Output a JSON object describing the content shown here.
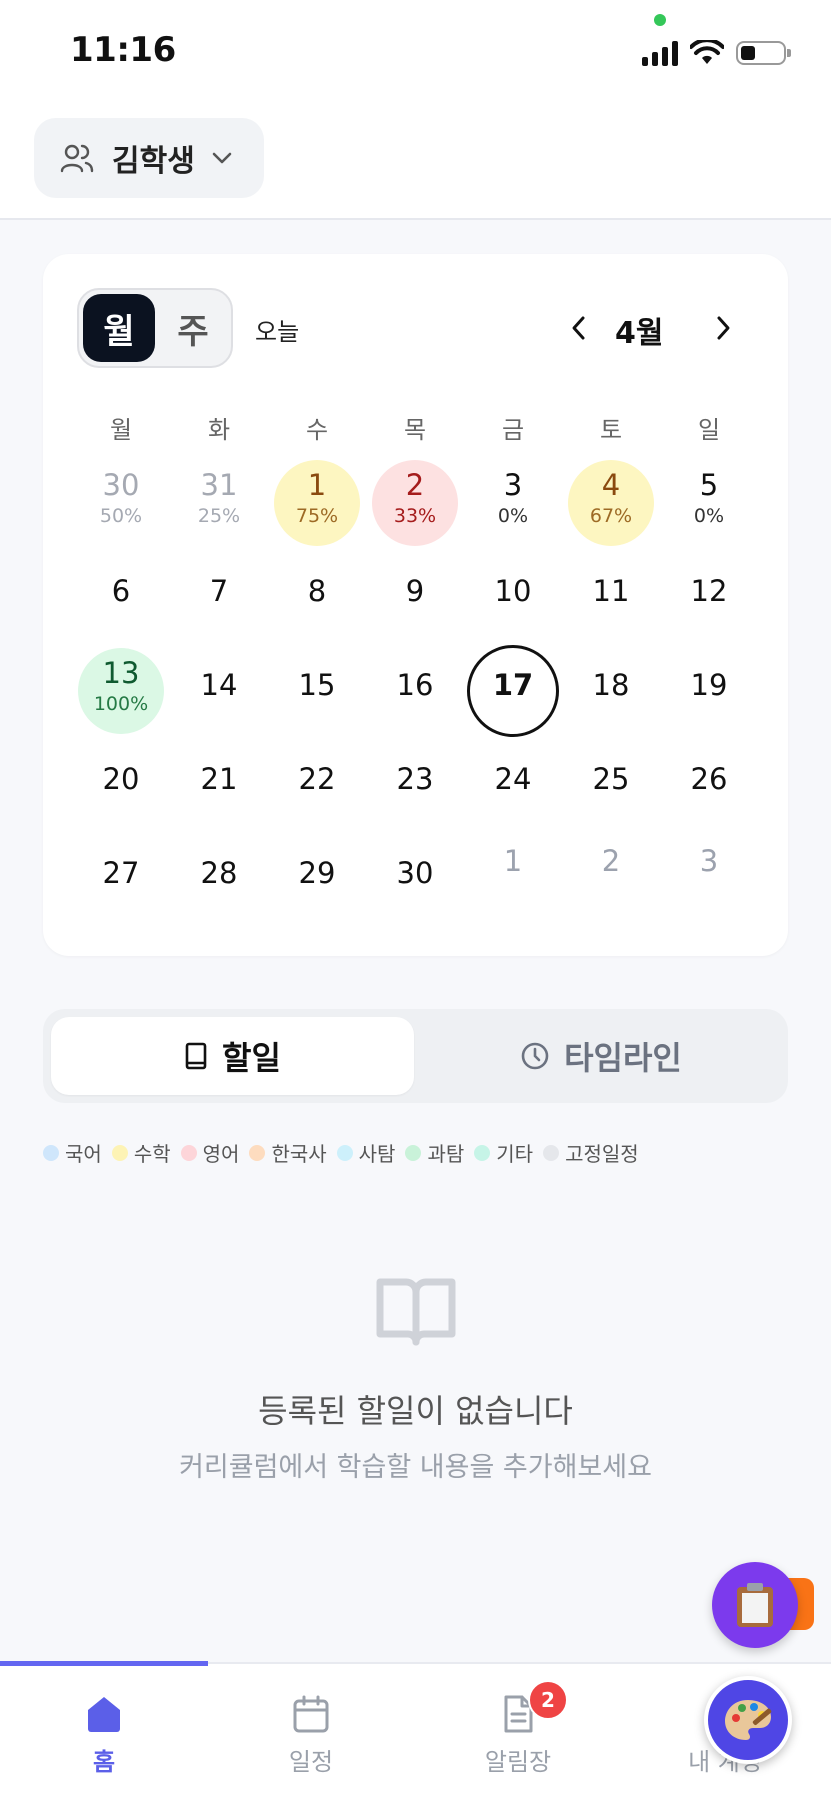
{
  "status_bar": {
    "time": "11:16"
  },
  "header": {
    "student_name": "김학생"
  },
  "calendar": {
    "view_month_label": "월",
    "view_week_label": "주",
    "today_label": "오늘",
    "month_label": "4월",
    "weekdays": [
      "월",
      "화",
      "수",
      "목",
      "금",
      "토",
      "일"
    ],
    "days": [
      {
        "num": "30",
        "pct": "50%",
        "style": "muted"
      },
      {
        "num": "31",
        "pct": "25%",
        "style": "muted"
      },
      {
        "num": "1",
        "pct": "75%",
        "style": "yellow"
      },
      {
        "num": "2",
        "pct": "33%",
        "style": "pink"
      },
      {
        "num": "3",
        "pct": "0%",
        "style": "blank"
      },
      {
        "num": "4",
        "pct": "67%",
        "style": "yellow"
      },
      {
        "num": "5",
        "pct": "0%",
        "style": "blank"
      },
      {
        "num": "6",
        "pct": "",
        "style": "plain"
      },
      {
        "num": "7",
        "pct": "",
        "style": "plain"
      },
      {
        "num": "8",
        "pct": "",
        "style": "plain"
      },
      {
        "num": "9",
        "pct": "",
        "style": "plain"
      },
      {
        "num": "10",
        "pct": "",
        "style": "plain"
      },
      {
        "num": "11",
        "pct": "",
        "style": "plain"
      },
      {
        "num": "12",
        "pct": "",
        "style": "plain"
      },
      {
        "num": "13",
        "pct": "100%",
        "style": "green"
      },
      {
        "num": "14",
        "pct": "",
        "style": "plain"
      },
      {
        "num": "15",
        "pct": "",
        "style": "plain"
      },
      {
        "num": "16",
        "pct": "",
        "style": "plain"
      },
      {
        "num": "17",
        "pct": "",
        "style": "today"
      },
      {
        "num": "18",
        "pct": "",
        "style": "plain"
      },
      {
        "num": "19",
        "pct": "",
        "style": "plain"
      },
      {
        "num": "20",
        "pct": "",
        "style": "plain"
      },
      {
        "num": "21",
        "pct": "",
        "style": "plain"
      },
      {
        "num": "22",
        "pct": "",
        "style": "plain"
      },
      {
        "num": "23",
        "pct": "",
        "style": "plain"
      },
      {
        "num": "24",
        "pct": "",
        "style": "plain"
      },
      {
        "num": "25",
        "pct": "",
        "style": "plain"
      },
      {
        "num": "26",
        "pct": "",
        "style": "plain"
      },
      {
        "num": "27",
        "pct": "",
        "style": "plain"
      },
      {
        "num": "28",
        "pct": "",
        "style": "plain"
      },
      {
        "num": "29",
        "pct": "",
        "style": "plain"
      },
      {
        "num": "30",
        "pct": "",
        "style": "plain"
      },
      {
        "num": "1",
        "pct": "",
        "style": "other"
      },
      {
        "num": "2",
        "pct": "",
        "style": "other"
      },
      {
        "num": "3",
        "pct": "",
        "style": "other"
      }
    ]
  },
  "tabs": {
    "todo": "할일",
    "timeline": "타임라인"
  },
  "legend": [
    {
      "label": "국어",
      "color": "#cfe6fb"
    },
    {
      "label": "수학",
      "color": "#fdf3b5"
    },
    {
      "label": "영어",
      "color": "#fdd5d9"
    },
    {
      "label": "한국사",
      "color": "#fddcbf"
    },
    {
      "label": "사탐",
      "color": "#cdf0fb"
    },
    {
      "label": "과탐",
      "color": "#c9f2d9"
    },
    {
      "label": "기타",
      "color": "#c6f4e7"
    },
    {
      "label": "고정일정",
      "color": "#e5e7eb"
    }
  ],
  "empty_state": {
    "title": "등록된 할일이 없습니다",
    "subtitle": "커리큘럼에서 학습할 내용을 추가해보세요"
  },
  "bottom_nav": {
    "home": "홈",
    "schedule": "일정",
    "notice": "알림장",
    "notice_badge": "2",
    "mine": "내 계정"
  },
  "colors": {
    "accent": "#5b5fe8",
    "fab": "#7c3aed",
    "dark": "#0b1220"
  },
  "icons": [
    "users-icon",
    "chevron-down-icon",
    "chevron-left-icon",
    "chevron-right-icon",
    "book-icon",
    "clock-icon",
    "book-open-icon",
    "clipboard-icon",
    "home-icon",
    "calendar-icon",
    "document-icon",
    "palette-icon"
  ]
}
